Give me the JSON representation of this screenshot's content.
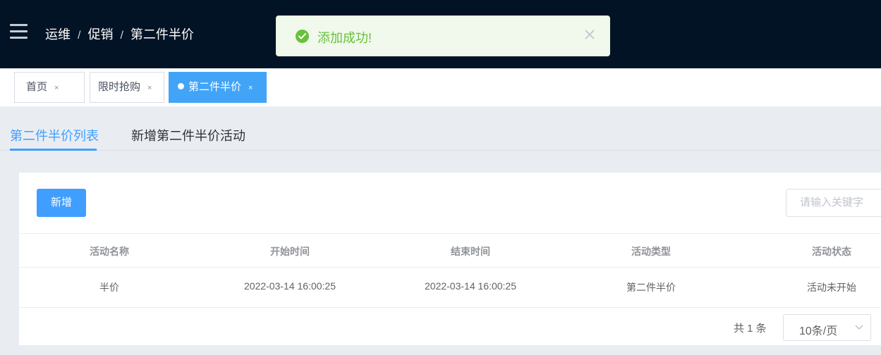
{
  "header": {
    "breadcrumb": [
      "运维",
      "促销",
      "第二件半价"
    ],
    "separator": "/"
  },
  "toast": {
    "message": "添加成功!",
    "type": "success",
    "color": "#67c23a"
  },
  "tags": [
    {
      "label": "首页",
      "close": "×"
    },
    {
      "label": "限时抢购",
      "close": "×"
    },
    {
      "label": "第二件半价",
      "close": "×",
      "active": true
    }
  ],
  "subtabs": [
    {
      "label": "第二件半价列表",
      "active": true
    },
    {
      "label": "新增第二件半价活动"
    }
  ],
  "toolbar": {
    "add_label": "新增",
    "search_placeholder": "请输入关键字"
  },
  "table": {
    "columns": [
      "活动名称",
      "开始时间",
      "结束时间",
      "活动类型",
      "活动状态"
    ],
    "rows": [
      [
        "半价",
        "2022-03-14 16:00:25",
        "2022-03-14 16:00:25",
        "第二件半价",
        "活动未开始"
      ]
    ]
  },
  "pagination": {
    "total_text": "共 1 条",
    "page_size": "10条/页"
  },
  "colors": {
    "accent": "#409eff",
    "header_bg": "#031326",
    "active_tag": "#42a4f7"
  }
}
